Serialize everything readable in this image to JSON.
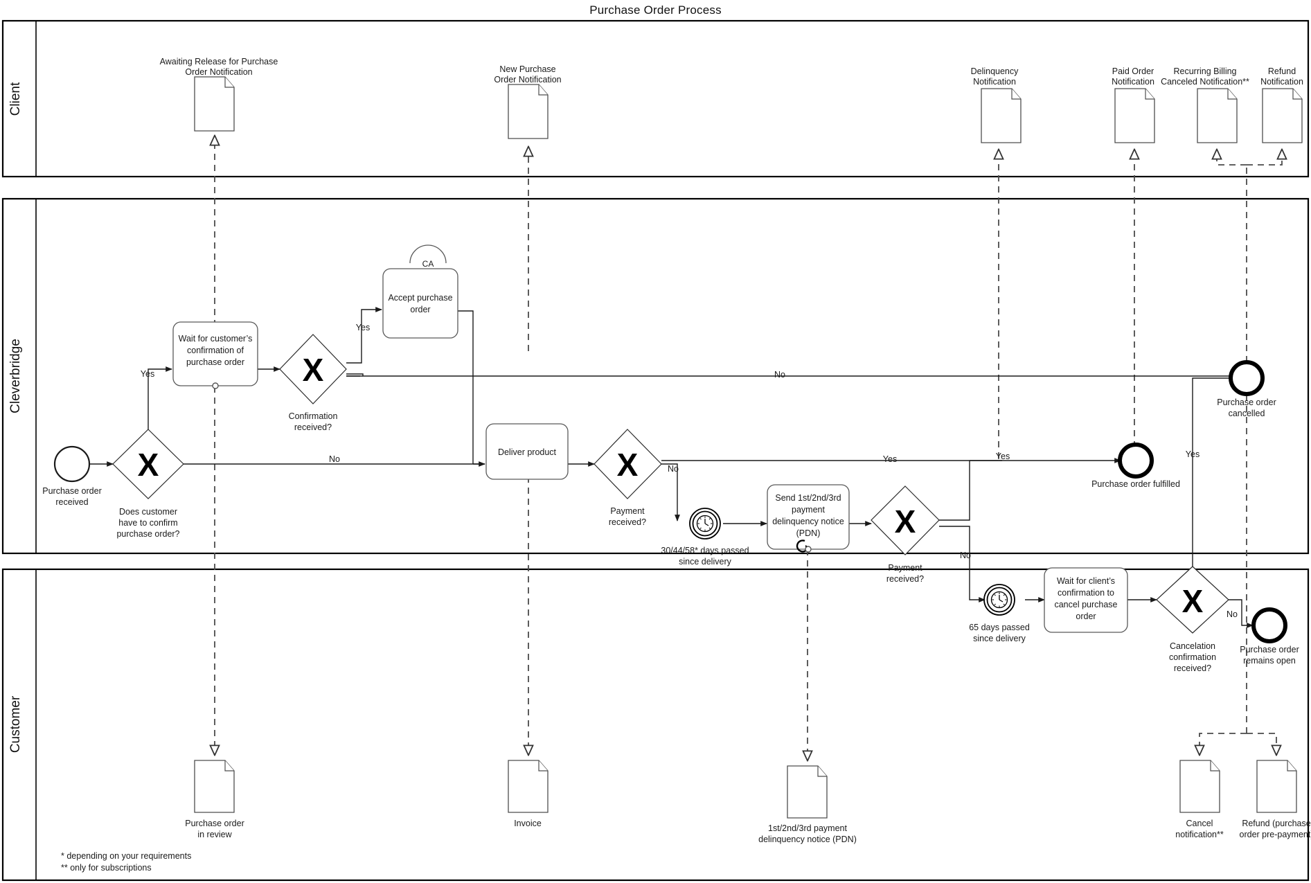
{
  "title": "Purchase Order Process",
  "lanes": [
    {
      "id": "client",
      "label": "Client"
    },
    {
      "id": "cleverbridge",
      "label": "Cleverbridge"
    },
    {
      "id": "customer",
      "label": "Customer"
    }
  ],
  "client_lane": {
    "artifacts": [
      {
        "name": "awaiting-release-notification",
        "label_line1": "Awaiting Release for Purchase",
        "label_line2": "Order Notification"
      },
      {
        "name": "new-purchase-order-notification",
        "label_line1": "New Purchase",
        "label_line2": "Order Notification"
      },
      {
        "name": "delinquency-notification",
        "label_line1": "Delinquency",
        "label_line2": "Notification"
      },
      {
        "name": "paid-order-notification",
        "label_line1": "Paid Order",
        "label_line2": "Notification"
      },
      {
        "name": "recurring-billing-canceled-notification",
        "label_line1": "Recurring Billing",
        "label_line2": "Canceled Notification**"
      },
      {
        "name": "refund-notification",
        "label_line1": "Refund",
        "label_line2": "Notification"
      }
    ]
  },
  "cleverbridge_lane": {
    "events": [
      {
        "name": "start-purchase-order-received",
        "type": "start",
        "label_line1": "Purchase order",
        "label_line2": "received"
      },
      {
        "name": "end-purchase-order-cancelled",
        "type": "end",
        "label_line1": "Purchase order",
        "label_line2": "cancelled"
      },
      {
        "name": "end-purchase-order-fulfilled",
        "type": "end",
        "label_line1": "Purchase order fulfilled",
        "label_line2": ""
      },
      {
        "name": "end-purchase-order-remains-open",
        "type": "end",
        "label_line1": "Purchase order",
        "label_line2": "remains open"
      },
      {
        "name": "timer-30-44-58-days",
        "type": "timer",
        "label_line1": "30/44/58* days passed",
        "label_line2": "since delivery"
      },
      {
        "name": "timer-65-days",
        "type": "timer",
        "label_line1": "65 days passed",
        "label_line2": "since delivery"
      }
    ],
    "tasks": [
      {
        "name": "task-wait-customer-confirmation",
        "lines": [
          "Wait for customer’s",
          "confirmation of",
          "purchase order"
        ],
        "marker": ""
      },
      {
        "name": "task-accept-purchase-order",
        "lines": [
          "Accept purchase",
          "order"
        ],
        "marker": "subprocess",
        "marker_label": "CA"
      },
      {
        "name": "task-deliver-product",
        "lines": [
          "Deliver product"
        ],
        "marker": ""
      },
      {
        "name": "task-send-pdn",
        "lines": [
          "Send 1st/2nd/3rd",
          "payment",
          "delinquency notice",
          "(PDN)"
        ],
        "marker": "loop"
      },
      {
        "name": "task-wait-client-cancel-confirmation",
        "lines": [
          "Wait for client’s",
          "confirmation to",
          "cancel purchase",
          "order"
        ],
        "marker": ""
      }
    ],
    "gateways": [
      {
        "name": "gateway-does-customer-confirm",
        "symbol": "X",
        "label_line1": "Does customer",
        "label_line2": "have to confirm",
        "label_line3": "purchase order?"
      },
      {
        "name": "gateway-confirmation-received",
        "symbol": "X",
        "label_line1": "Confirmation",
        "label_line2": "received?",
        "label_line3": ""
      },
      {
        "name": "gateway-payment-received-1",
        "symbol": "X",
        "label_line1": "Payment",
        "label_line2": "received?",
        "label_line3": ""
      },
      {
        "name": "gateway-payment-received-2",
        "symbol": "X",
        "label_line1": "Payment",
        "label_line2": "received?",
        "label_line3": ""
      },
      {
        "name": "gateway-cancelation-confirmation-received",
        "symbol": "X",
        "label_line1": "Cancelation",
        "label_line2": "confirmation",
        "label_line3": "received?"
      }
    ],
    "flow_labels": {
      "confirm_yes": "Yes",
      "confirm_no": "No",
      "confirmation_received_yes": "Yes",
      "confirmation_received_no": "No",
      "payment1_no": "No",
      "payment2_yes": "Yes",
      "payment2_no": "No",
      "fulfilled_yes": "Yes",
      "cancel_yes": "Yes",
      "cancel_no": "No"
    }
  },
  "customer_lane": {
    "artifacts": [
      {
        "name": "purchase-order-in-review",
        "label_line1": "Purchase order",
        "label_line2": "in review"
      },
      {
        "name": "invoice",
        "label_line1": "Invoice",
        "label_line2": ""
      },
      {
        "name": "payment-delinquency-notice",
        "label_line1": "1st/2nd/3rd payment",
        "label_line2": "delinquency notice (PDN)"
      },
      {
        "name": "cancel-notification",
        "label_line1": "Cancel",
        "label_line2": "notification**"
      },
      {
        "name": "refund-purchase-order-prepayment",
        "label_line1": "Refund (purchase",
        "label_line2": "order pre-payment)"
      }
    ]
  },
  "footnotes": [
    "* depending on your requirements",
    "** only for subscriptions"
  ],
  "colors": {
    "stroke": "#1a1a1a",
    "task_stroke": "#595959",
    "message_flow": "#4a4a4a",
    "background": "#ffffff"
  }
}
